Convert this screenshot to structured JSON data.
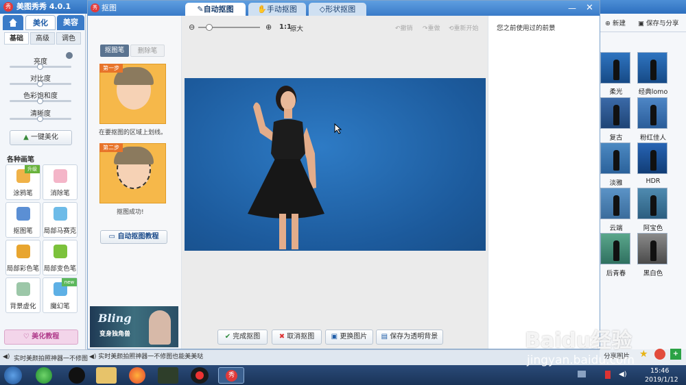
{
  "app": {
    "title": "美图秀秀 4.0.1",
    "logo_text": "秀",
    "top_tabs": [
      "美化",
      "美容"
    ],
    "sub_tabs": [
      "基础",
      "高级",
      "调色"
    ],
    "sliders": [
      {
        "label": "亮度",
        "value": 0.5
      },
      {
        "label": "对比度",
        "value": 0.5
      },
      {
        "label": "色彩饱和度",
        "value": 0.5
      },
      {
        "label": "清晰度",
        "value": 0.5
      }
    ],
    "one_click_button": "一键美化",
    "tools_heading": "各种画笔",
    "tools": [
      {
        "label": "涂鸦笔",
        "badge": "升级"
      },
      {
        "label": "消除笔",
        "badge": ""
      },
      {
        "label": "抠图笔",
        "badge": ""
      },
      {
        "label": "局部马赛克",
        "badge": ""
      },
      {
        "label": "局部彩色笔",
        "badge": ""
      },
      {
        "label": "局部变色笔",
        "badge": ""
      },
      {
        "label": "背景虚化",
        "badge": ""
      },
      {
        "label": "魔幻笔",
        "badge": "new"
      }
    ],
    "tutorial_button": "美化教程",
    "status_text_1": "实时美颜拍照神器一不修图",
    "status_text_2": "实时美颜拍照神器一不修图也能美美哒"
  },
  "right_panel": {
    "new_button": "新建",
    "save_share_button": "保存与分享",
    "presets": [
      "柔光",
      "经典lomo",
      "复古",
      "粉红佳人",
      "淡雅",
      "HDR",
      "云端",
      "阿宝色",
      "后青春",
      "黑白色"
    ],
    "share_label": "分享图片"
  },
  "dialog": {
    "title": "抠图",
    "tabs": [
      "自动抠图",
      "手动抠图",
      "形状抠图"
    ],
    "active_tab": "自动抠图",
    "zoom_ratio": "1:1",
    "zoom_original": "原大",
    "zoom_level": 0.18,
    "undo": "撤销",
    "redo": "重做",
    "restart": "重新开始",
    "brush_tabs": [
      "抠图笔",
      "删除笔"
    ],
    "step1_badge": "第一步",
    "step1_text": "在要抠图的区域上划线。",
    "step2_badge": "第二步",
    "step2_text": "抠图成功!",
    "tutorial_button": "自动抠图教程",
    "ad_title": "Bling",
    "ad_subtitle": "变身独角兽",
    "recent_bg_label": "您之前使用过的前景",
    "buttons": [
      "完成抠图",
      "取消抠图",
      "更换图片",
      "保存为透明背景"
    ]
  },
  "taskbar": {
    "time": "15:46",
    "date": "2019/1/12",
    "record_label": "秀"
  },
  "watermark": {
    "brand": "Baidu经验",
    "url": "jingyan.baidu.com"
  }
}
